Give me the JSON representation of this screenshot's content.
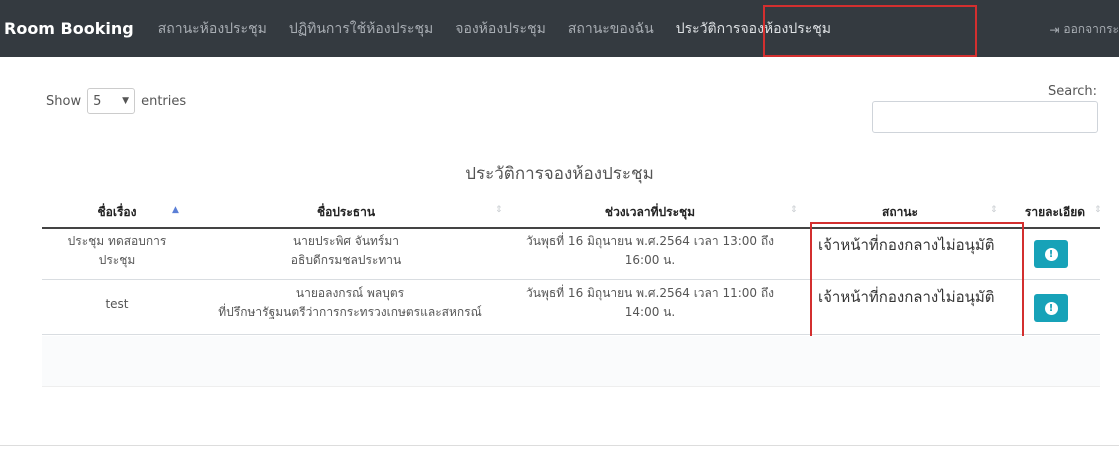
{
  "navbar": {
    "brand": "Room Booking",
    "items": [
      {
        "label": "สถานะห้องประชุม"
      },
      {
        "label": "ปฏิทินการใช้ห้องประชุม"
      },
      {
        "label": "จองห้องประชุม"
      },
      {
        "label": "สถานะของฉัน"
      },
      {
        "label": "ประวัติการจองห้องประชุม"
      }
    ],
    "logout_label": "ออกจากระ"
  },
  "length": {
    "show": "Show",
    "value": "5",
    "entries": "entries"
  },
  "search": {
    "label": "Search:"
  },
  "caption": "ประวัติการจองห้องประชุม",
  "table": {
    "headers": [
      "ชื่อเรื่อง",
      "ชื่อประธาน",
      "ช่วงเวลาที่ประชุม",
      "สถานะ",
      "รายละเอียด"
    ],
    "rows": [
      {
        "title": "ประชุม ทดสอบการประชุม",
        "title_l1": "ประชุม ทดสอบการ",
        "title_l2": "ประชุม",
        "chair_l1": "นายประพิศ จันทร์มา",
        "chair_l2": "อธิบดีกรมชลประทาน",
        "time_l1": "วันพุธที่ 16 มิถุนายน พ.ศ.2564 เวลา 13:00 ถึง",
        "time_l2": "16:00 น.",
        "status": "เจ้าหน้าที่กองกลางไม่อนุมัติ"
      },
      {
        "title_l1": "test",
        "chair_l1": "นายอลงกรณ์ พลบุตร",
        "chair_l2": "ที่ปรึกษารัฐมนตรีว่าการกระทรวงเกษตรและสหกรณ์",
        "time_l1": "วันพุธที่ 16 มิถุนายน พ.ศ.2564 เวลา 11:00 ถึง",
        "time_l2": "14:00 น.",
        "status": "เจ้าหน้าที่กองกลางไม่อนุมัติ"
      }
    ]
  },
  "colors": {
    "navbar": "#343a40",
    "info_button": "#17a2b8",
    "highlight": "#d32f2f"
  }
}
